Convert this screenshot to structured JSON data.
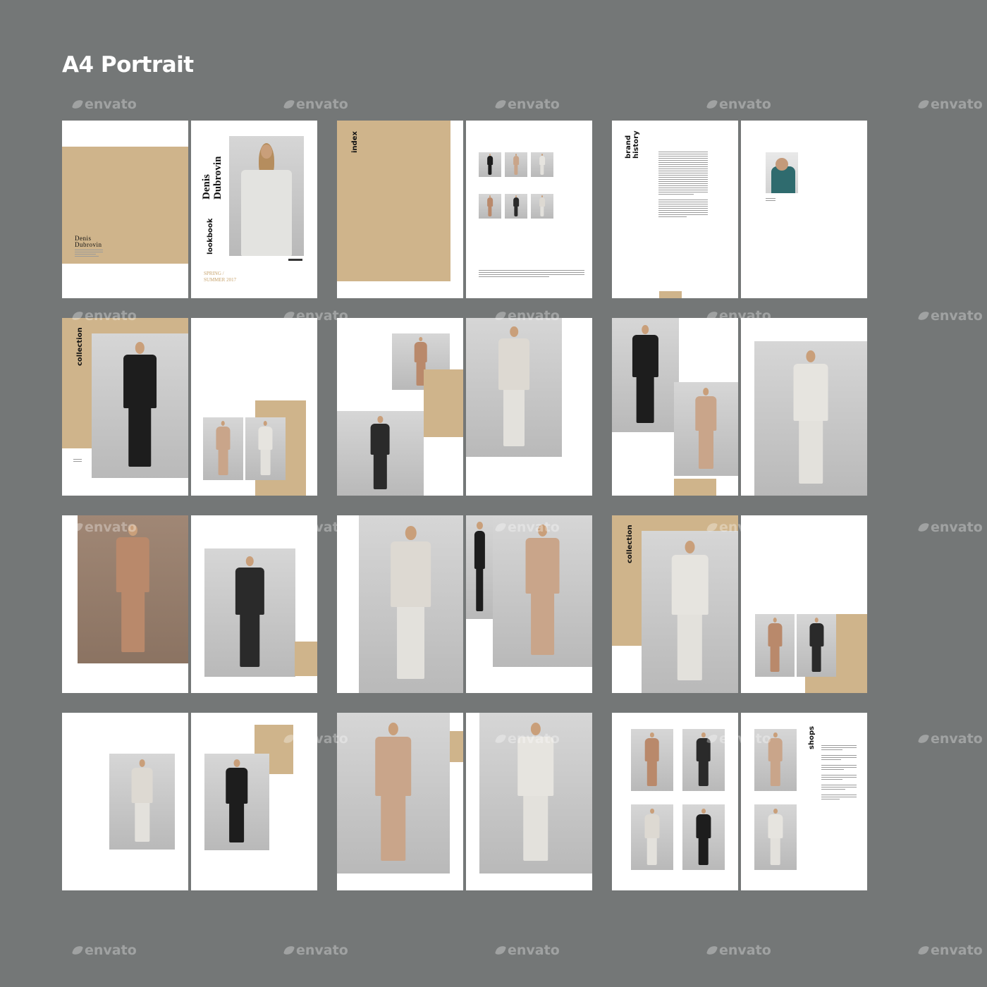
{
  "heading": "A4 Portrait",
  "watermark": "envato",
  "cover": {
    "back_name_line1": "Denis",
    "back_name_line2": "Dubrovin",
    "front_name_line1": "Denis",
    "front_name_line2": "Dubrovin",
    "label": "lookbook",
    "season_line1": "SPRING /",
    "season_line2": "SUMMER 2017"
  },
  "sections": {
    "index": "index",
    "brand_line1": "brand",
    "brand_line2": "history",
    "collection_a": "collection",
    "collection_b": "collection",
    "shops": "shops"
  },
  "colors": {
    "background": "#747777",
    "accent_tan": "#cfb48b",
    "page": "#ffffff"
  }
}
